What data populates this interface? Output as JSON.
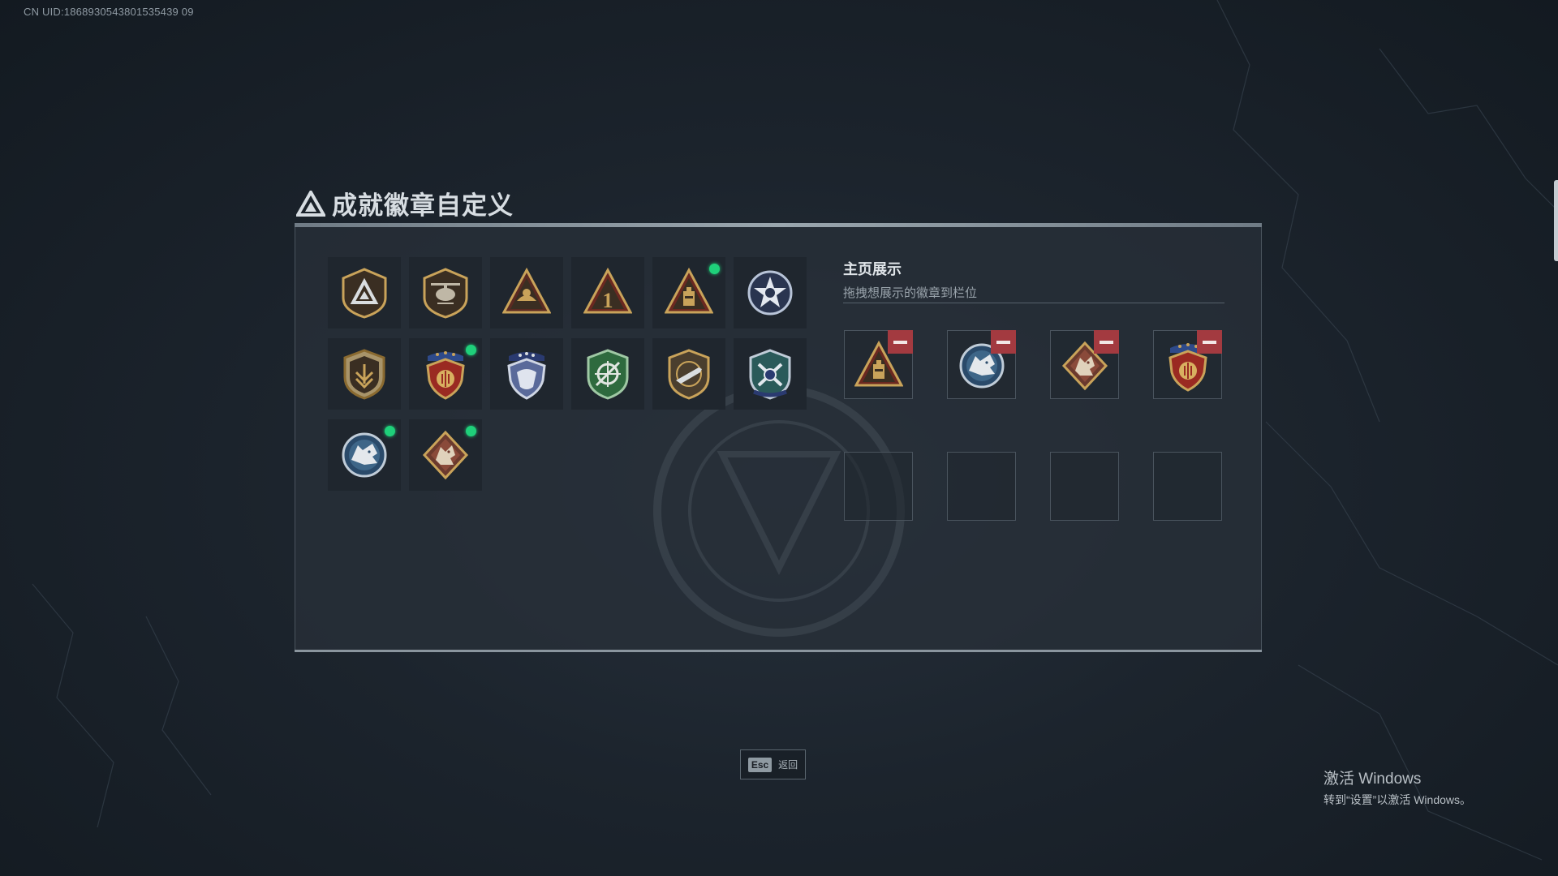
{
  "uid_label": "CN UID:1868930543801535439 09",
  "page": {
    "title": "成就徽章自定义",
    "title_icon": "triangle-a-logo-icon"
  },
  "collection": {
    "rows": [
      [
        {
          "icon": "triangle-shield-badge-icon",
          "new": false
        },
        {
          "icon": "helicopter-shield-badge-icon",
          "new": false
        },
        {
          "icon": "cargo-triangle-badge-icon",
          "new": false
        },
        {
          "icon": "number-one-triangle-badge-icon",
          "new": false
        },
        {
          "icon": "battery-triangle-badge-icon",
          "new": true
        },
        {
          "icon": "star-circle-badge-icon",
          "new": false
        }
      ],
      [
        {
          "icon": "chevron-shield-badge-icon",
          "new": false
        },
        {
          "icon": "red-crest-badge-icon",
          "new": true
        },
        {
          "icon": "blue-crest-badge-icon",
          "new": false
        },
        {
          "icon": "green-crosshair-shield-badge-icon",
          "new": false
        },
        {
          "icon": "rifle-shield-badge-icon",
          "new": false
        },
        {
          "icon": "crossed-arrows-shield-badge-icon",
          "new": false
        }
      ],
      [
        {
          "icon": "wolf-circle-badge-icon",
          "new": true
        },
        {
          "icon": "dragon-diamond-badge-icon",
          "new": true
        }
      ]
    ]
  },
  "showcase": {
    "title": "主页展示",
    "subtitle": "拖拽想展示的徽章到栏位",
    "slots": [
      {
        "icon": "battery-triangle-badge-icon",
        "filled": true
      },
      {
        "icon": "wolf-circle-badge-icon",
        "filled": true
      },
      {
        "icon": "dragon-diamond-badge-icon",
        "filled": true
      },
      {
        "icon": "red-crest-badge-icon",
        "filled": true
      },
      {
        "filled": false
      },
      {
        "filled": false
      },
      {
        "filled": false
      },
      {
        "filled": false
      }
    ]
  },
  "footer": {
    "esc_key": "Esc",
    "esc_label": "返回"
  },
  "windows_activation": {
    "line1": "激活 Windows",
    "line2": "转到“设置”以激活 Windows。"
  },
  "colors": {
    "accent_new": "#1fd07a",
    "remove_red": "#a33a40"
  }
}
